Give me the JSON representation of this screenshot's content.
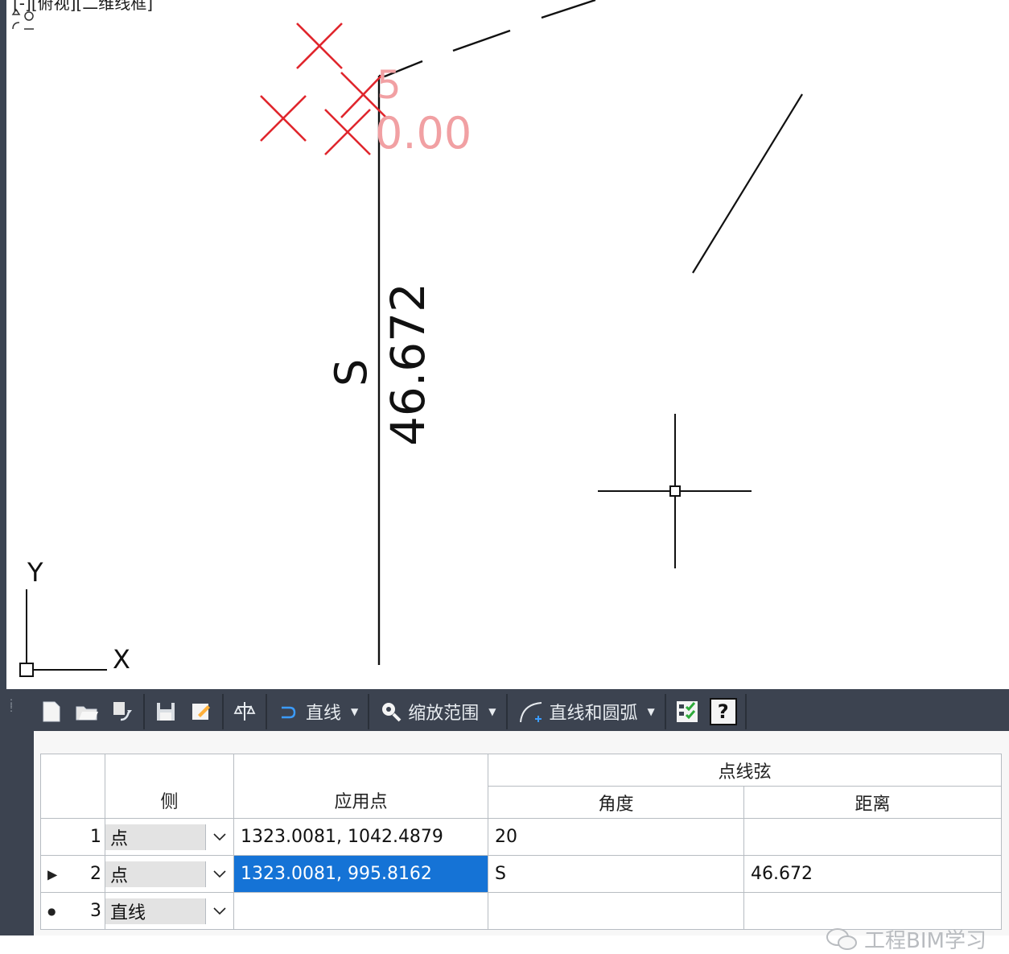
{
  "viewport": {
    "label": "[-][俯视][二维线框]",
    "dimension_text": "46.672",
    "direction_text": "S",
    "red_label_top": "5",
    "red_label_bottom": "0.00",
    "ucs_x": "X",
    "ucs_y": "Y"
  },
  "toolbar": {
    "line_label": "直线",
    "zoom_label": "缩放范围",
    "arc_label": "直线和圆弧",
    "help_label": "?"
  },
  "grid": {
    "group_header": "点线弦",
    "col_side": "侧",
    "col_point": "应用点",
    "col_angle": "角度",
    "col_distance": "距离",
    "rows": [
      {
        "num": "1",
        "side": "点",
        "point": "1323.0081, 1042.4879",
        "angle": "20",
        "distance": ""
      },
      {
        "num": "2",
        "side": "点",
        "point": "1323.0081, 995.8162",
        "angle": "S",
        "distance": "46.672"
      },
      {
        "num": "3",
        "side": "直线",
        "point": "",
        "angle": "",
        "distance": ""
      }
    ]
  },
  "watermark": {
    "text": "工程BIM学习"
  },
  "colors": {
    "selection": "#1573d6",
    "panel": "#3c4350",
    "red_marks": "#e0262d"
  }
}
